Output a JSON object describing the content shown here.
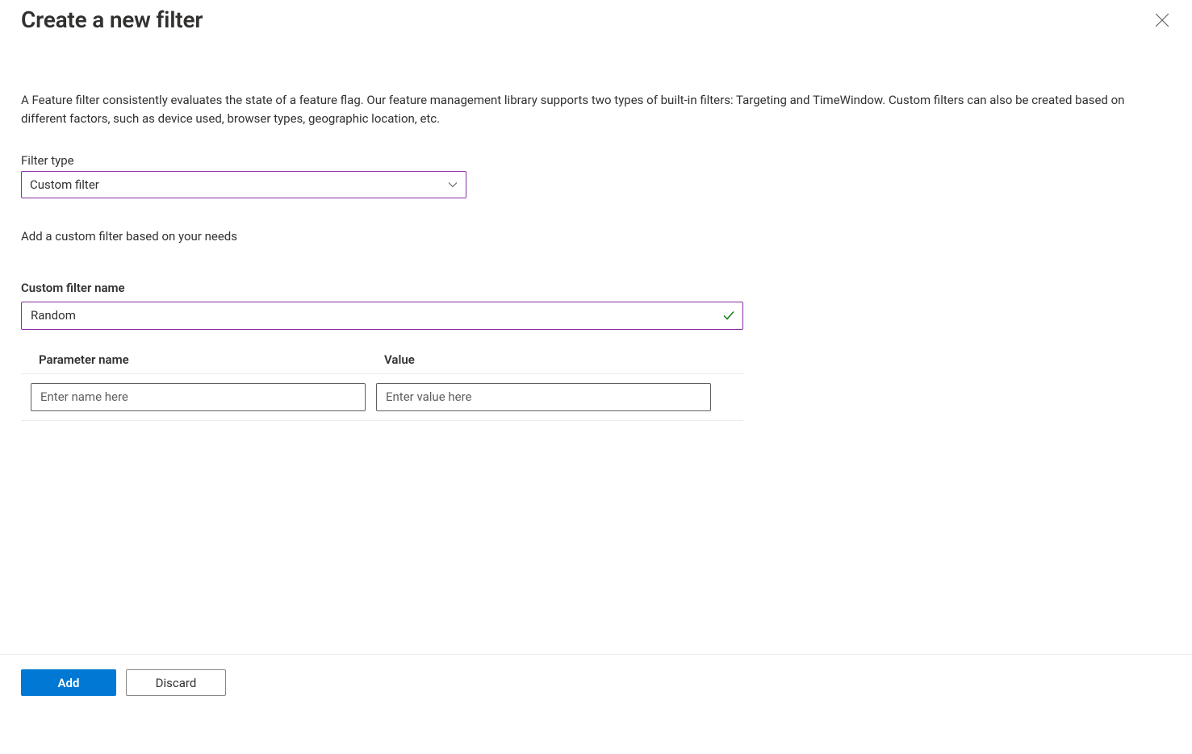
{
  "header": {
    "title": "Create a new filter"
  },
  "description": "A Feature filter consistently evaluates the state of a feature flag. Our feature management library supports two types of built-in filters: Targeting and TimeWindow. Custom filters can also be created based on different factors, such as device used, browser types, geographic location, etc.",
  "filterType": {
    "label": "Filter type",
    "value": "Custom filter"
  },
  "helper": "Add a custom filter based on your needs",
  "customName": {
    "label": "Custom filter name",
    "value": "Random"
  },
  "paramTable": {
    "headers": {
      "name": "Parameter name",
      "value": "Value"
    },
    "row": {
      "namePlaceholder": "Enter name here",
      "valuePlaceholder": "Enter value here",
      "nameValue": "",
      "valueValue": ""
    }
  },
  "footer": {
    "add": "Add",
    "discard": "Discard"
  }
}
